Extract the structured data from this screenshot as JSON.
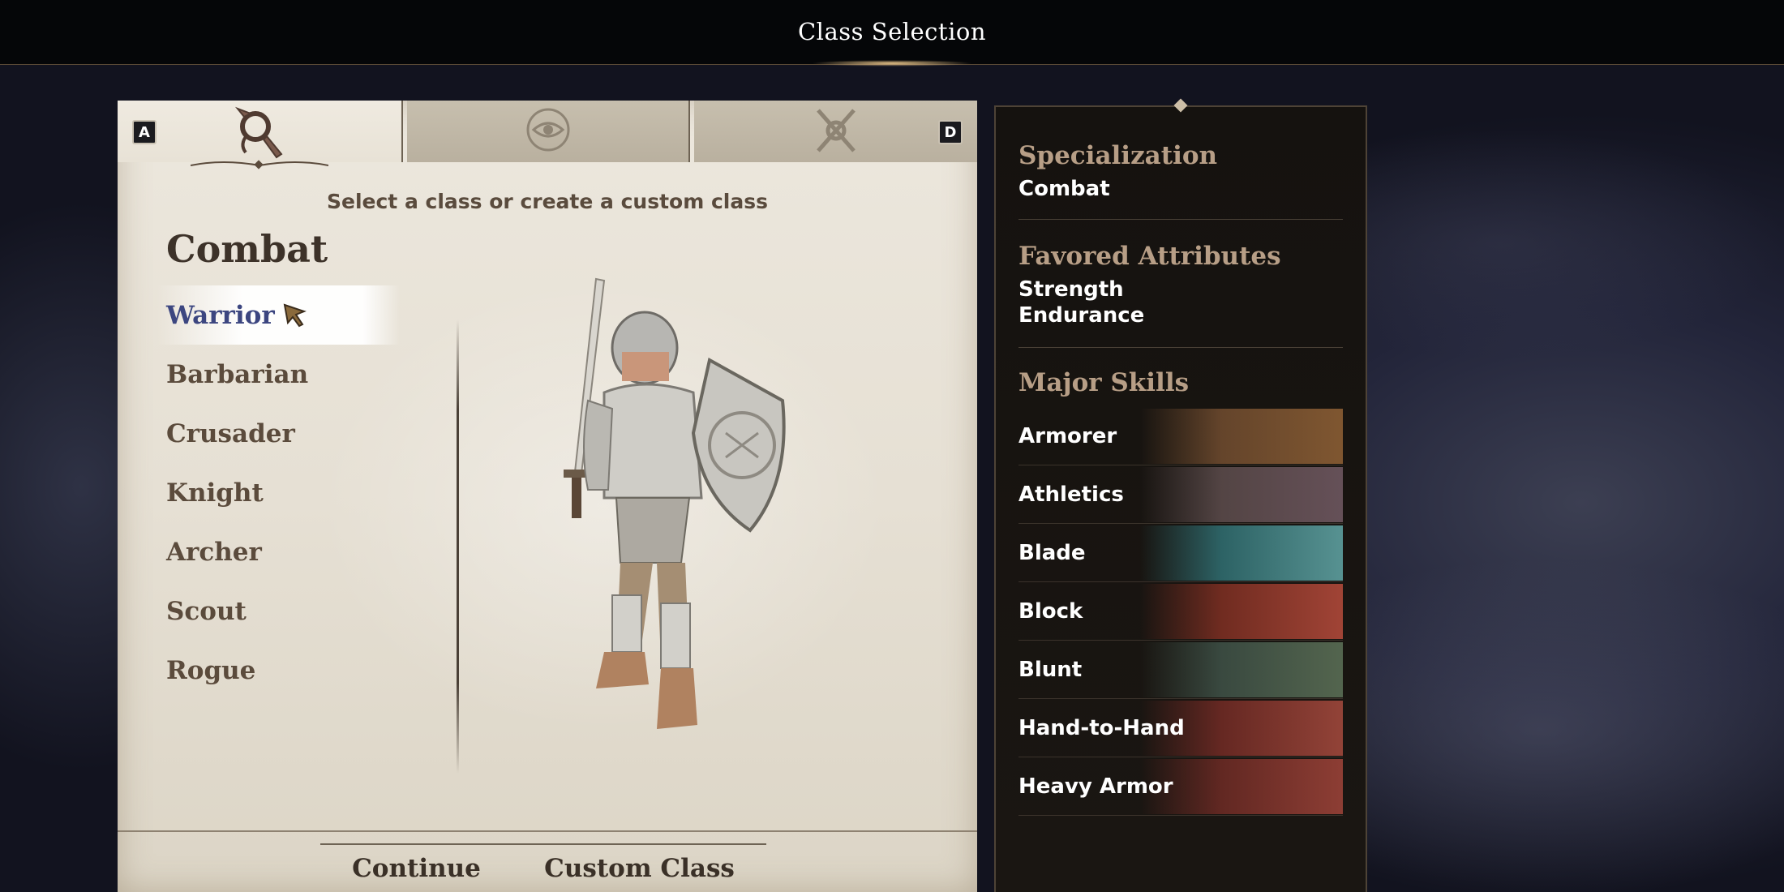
{
  "header": {
    "title": "Class Selection"
  },
  "tabs": [
    {
      "icon": "axe-icon",
      "active": true,
      "key": "A"
    },
    {
      "icon": "eye-emblem-icon",
      "active": false
    },
    {
      "icon": "crossed-daggers-icon",
      "active": false,
      "key": "D"
    }
  ],
  "prompt": "Select a class or create a custom class",
  "category": "Combat",
  "classes": [
    "Warrior",
    "Barbarian",
    "Crusader",
    "Knight",
    "Archer",
    "Scout",
    "Rogue"
  ],
  "selected_class": "Warrior",
  "buttons": {
    "continue": "Continue",
    "custom_class": "Custom Class"
  },
  "info": {
    "specialization_title": "Specialization",
    "specialization": "Combat",
    "attributes_title": "Favored Attributes",
    "attributes": [
      "Strength",
      "Endurance"
    ],
    "skills_title": "Major Skills",
    "skills": [
      "Armorer",
      "Athletics",
      "Blade",
      "Block",
      "Blunt",
      "Hand-to-Hand",
      "Heavy Armor"
    ]
  },
  "colors": {
    "selected_class_text": "#3c4680",
    "parchment": "#e6e0d4",
    "info_title": "#b79e86"
  }
}
